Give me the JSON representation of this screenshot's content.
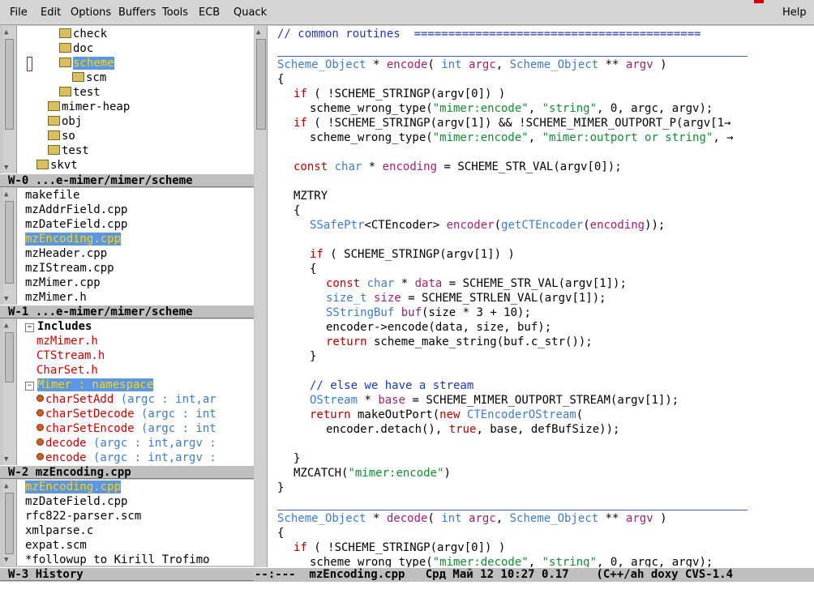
{
  "menubar": {
    "items": [
      "File",
      "Edit",
      "Options",
      "Buffers",
      "Tools",
      "ECB",
      "Quack"
    ],
    "help": "Help"
  },
  "directories": {
    "items": [
      "check",
      "doc",
      "scheme",
      "scm",
      "test",
      "mimer-heap",
      "obj",
      "so",
      "test",
      "skvt"
    ],
    "modeline": "W-0 ...e-mimer/mimer/scheme"
  },
  "sources": {
    "items": [
      "makefile",
      "mzAddrField.cpp",
      "mzDateField.cpp",
      "mzEncoding.cpp",
      "mzHeader.cpp",
      "mzIStream.cpp",
      "mzMimer.cpp",
      "mzMimer.h"
    ],
    "modeline": "W-1 ...e-mimer/mimer/scheme"
  },
  "methods": {
    "includes_label": "Includes",
    "includes": [
      "mzMimer.h",
      "CTStream.h",
      "CharSet.h"
    ],
    "namespace": "Mimer : namespace",
    "functions": [
      {
        "name": "charSetAdd",
        "args": " (argc : int,ar"
      },
      {
        "name": "charSetDecode",
        "args": " (argc : int"
      },
      {
        "name": "charSetEncode",
        "args": " (argc : int"
      },
      {
        "name": "decode",
        "args": " (argc : int,argv :"
      },
      {
        "name": "encode",
        "args": " (argc : int,argv :"
      }
    ],
    "modeline": "W-2 mzEncoding.cpp"
  },
  "history": {
    "items": [
      "mzEncoding.cpp",
      "mzDateField.cpp",
      "rfc822-parser.scm",
      "xmlparse.c",
      "expat.scm",
      "*followup to Kirill Trofimo"
    ],
    "modeline": "W-3 History"
  },
  "editor": {
    "header_comment": "// common routines  ==========================================",
    "modeline": "--:---  mzEncoding.cpp   Срд Май 12 10:27 0.17    (C++/ah doxy CVS-1.4"
  },
  "colors": {
    "highlight": "#5b97e6",
    "keyword": "#b30000",
    "type": "#3e7cc7",
    "string": "#138a34",
    "function": "#a02070"
  }
}
